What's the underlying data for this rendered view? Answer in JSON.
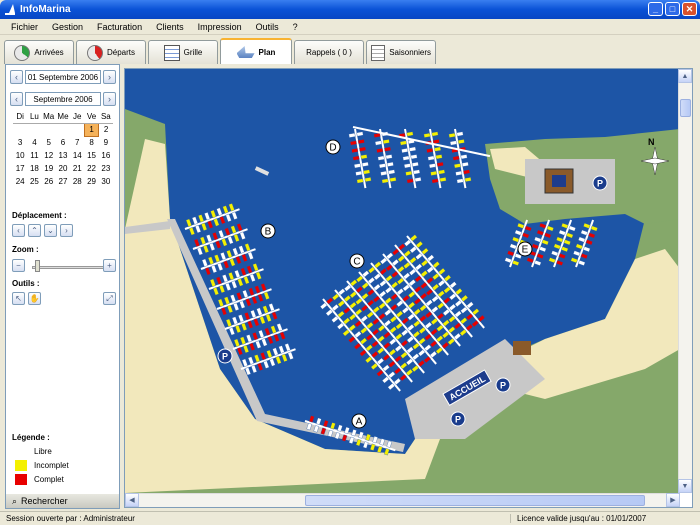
{
  "window": {
    "title": "InfoMarina"
  },
  "menu": [
    "Fichier",
    "Gestion",
    "Facturation",
    "Clients",
    "Impression",
    "Outils",
    "?"
  ],
  "tabs": [
    {
      "label": "Arrivées",
      "icon": "arrivals-pie-icon"
    },
    {
      "label": "Départs",
      "icon": "departures-pie-icon"
    },
    {
      "label": "Grille",
      "icon": "grid-icon"
    },
    {
      "label": "Plan",
      "icon": "boat-icon",
      "active": true
    },
    {
      "label": "Rappels ( 0 )",
      "icon": ""
    },
    {
      "label": "Saisonniers",
      "icon": "seasonal-list-icon"
    }
  ],
  "sidebar": {
    "selected_date": "01 Septembre 2006",
    "month": "Septembre 2006",
    "weekdays": [
      "Di",
      "Lu",
      "Ma",
      "Me",
      "Je",
      "Ve",
      "Sa"
    ],
    "weeks": [
      [
        "",
        "",
        "",
        "",
        "",
        "1",
        "2"
      ],
      [
        "3",
        "4",
        "5",
        "6",
        "7",
        "8",
        "9"
      ],
      [
        "10",
        "11",
        "12",
        "13",
        "14",
        "15",
        "16"
      ],
      [
        "17",
        "18",
        "19",
        "20",
        "21",
        "22",
        "23"
      ],
      [
        "24",
        "25",
        "26",
        "27",
        "28",
        "29",
        "30"
      ]
    ],
    "today": "1",
    "deplacement_label": "Déplacement :",
    "zoom_label": "Zoom :",
    "zoom_level": 0.05,
    "outils_label": "Outils :",
    "legend_label": "Légende :",
    "legend": [
      {
        "label": "Libre",
        "color": "#ffffff"
      },
      {
        "label": "Incomplet",
        "color": "#f4f000"
      },
      {
        "label": "Complet",
        "color": "#e80000"
      }
    ],
    "search_label": "Rechercher"
  },
  "map": {
    "colors": {
      "water": "#1d55a6",
      "land": "#85a86a",
      "beach": "#f2e8bc",
      "quay": "#c8c8c8",
      "parking": "#1a3c8c"
    },
    "pontoons": [
      "A",
      "B",
      "C",
      "D",
      "E"
    ],
    "office_label": "ACCUEIL",
    "parking_label": "P",
    "compass_label": "N"
  },
  "status": {
    "session": "Session ouverte par :  Administrateur",
    "license": "Licence valide jusqu'au : 01/01/2007"
  }
}
